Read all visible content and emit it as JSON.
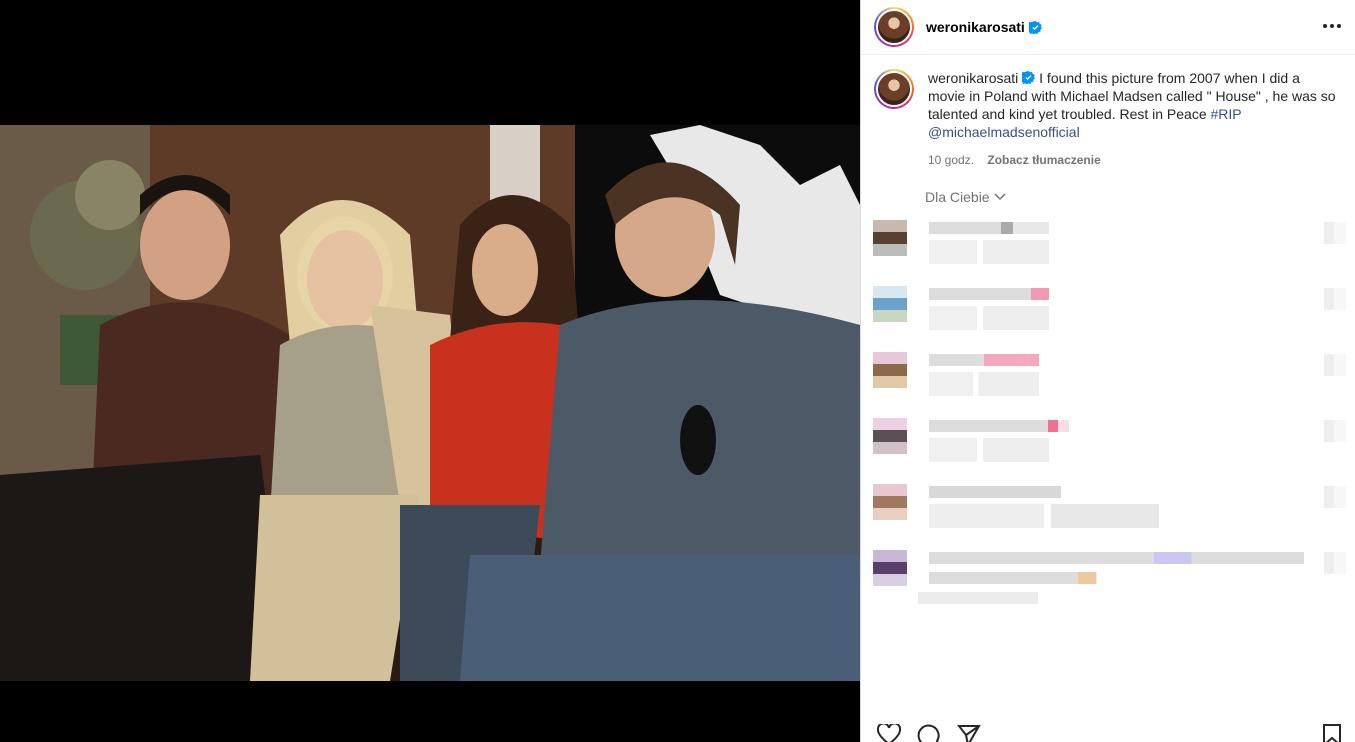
{
  "post": {
    "username": "weronikarosati",
    "caption_text": " I found this picture from 2007 when I did a movie in Poland with Michael Madsen called \" House\" , he was so talented and kind yet troubled. Rest in Peace ",
    "hashtag": "#RIP",
    "mention": "@michaelmadsenofficial",
    "time_ago": "10 godz.",
    "translate_label": "Zobacz tłumaczenie"
  },
  "comments_section": {
    "filter_label": "Dla Ciebie"
  },
  "icons": {
    "more": "more-options-icon",
    "verified": "verified-badge-icon",
    "like": "heart-icon",
    "comment": "comment-icon",
    "share": "send-icon",
    "save": "bookmark-icon"
  },
  "colors": {
    "accent": "#0095f6",
    "link": "#385185",
    "secondary_text": "#737373"
  }
}
